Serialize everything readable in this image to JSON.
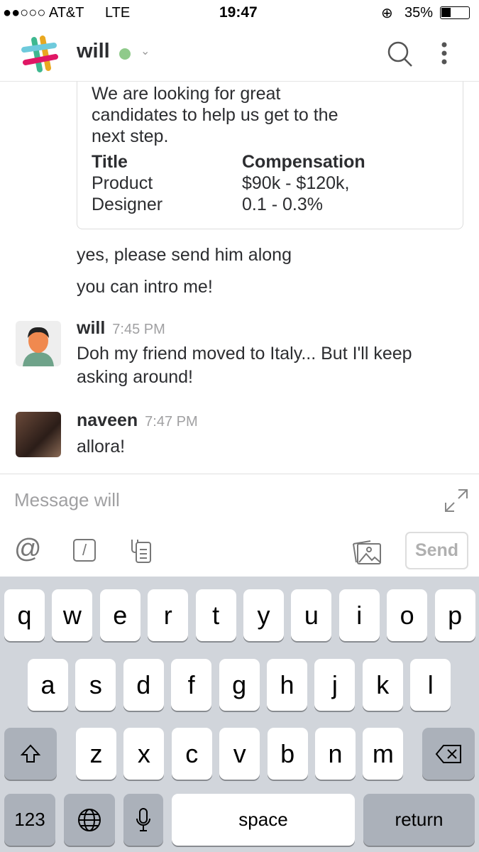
{
  "status": {
    "carrier": "●●○○○ AT&T",
    "network": "LTE",
    "time": "19:47",
    "battery": "35%"
  },
  "header": {
    "channel": "will",
    "presence_color": "#8fca8a",
    "icons": [
      "slack-logo",
      "search-icon",
      "more-icon"
    ]
  },
  "card": {
    "partial_line": "We are looking for great",
    "lines": [
      "candidates to help us get to the",
      "next step."
    ],
    "table": {
      "headers": [
        "Title",
        "Compensation"
      ],
      "rows": [
        [
          "Product",
          "$90k - $120k,"
        ],
        [
          "Designer",
          "0.1 - 0.3%"
        ]
      ]
    }
  },
  "messages": [
    {
      "text": "yes, please send him along"
    },
    {
      "text": "you can intro me!"
    },
    {
      "author": "will",
      "time": "7:45 PM",
      "lines": [
        "Doh my friend moved to Italy... But I'll keep",
        "asking around!"
      ]
    },
    {
      "author": "naveen",
      "time": "7:47 PM",
      "lines": [
        "allora!"
      ]
    }
  ],
  "composer": {
    "placeholder": "Message will",
    "send": "Send"
  },
  "keyboard": {
    "row1": [
      "q",
      "w",
      "e",
      "r",
      "t",
      "y",
      "u",
      "i",
      "o",
      "p"
    ],
    "row2": [
      "a",
      "s",
      "d",
      "f",
      "g",
      "h",
      "j",
      "k",
      "l"
    ],
    "row3": [
      "z",
      "x",
      "c",
      "v",
      "b",
      "n",
      "m"
    ],
    "numbers": "123",
    "space": "space",
    "return": "return"
  }
}
